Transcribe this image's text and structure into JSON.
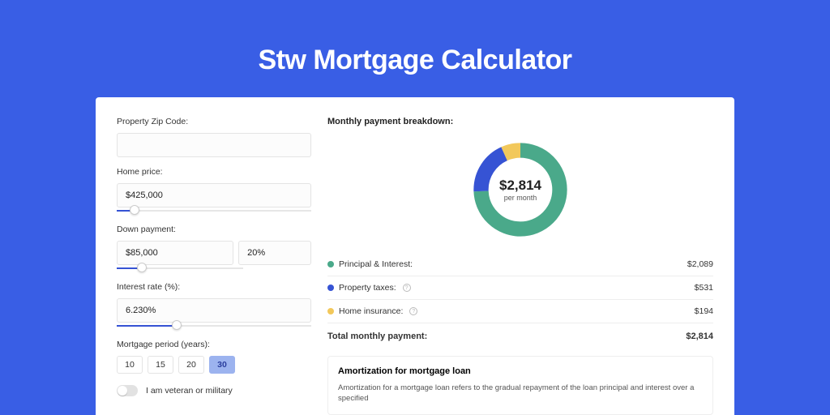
{
  "page": {
    "title": "Stw Mortgage Calculator"
  },
  "form": {
    "zip_label": "Property Zip Code:",
    "zip_value": "",
    "home_price_label": "Home price:",
    "home_price_value": "$425,000",
    "home_price_slider_pct": 9,
    "down_payment_label": "Down payment:",
    "down_payment_value": "$85,000",
    "down_payment_pct_value": "20%",
    "down_payment_slider_pct": 20,
    "interest_label": "Interest rate (%):",
    "interest_value": "6.230%",
    "interest_slider_pct": 31,
    "period_label": "Mortgage period (years):",
    "period_options": [
      "10",
      "15",
      "20",
      "30"
    ],
    "period_selected": "30",
    "veteran_label": "I am veteran or military",
    "veteran_on": false
  },
  "breakdown": {
    "title": "Monthly payment breakdown:",
    "center_amount": "$2,814",
    "center_sub": "per month",
    "items": [
      {
        "label": "Principal & Interest:",
        "value": "$2,089",
        "color": "#4aa98a",
        "info": false
      },
      {
        "label": "Property taxes:",
        "value": "$531",
        "color": "#3653d4",
        "info": true
      },
      {
        "label": "Home insurance:",
        "value": "$194",
        "color": "#f2c85b",
        "info": true
      }
    ],
    "total_label": "Total monthly payment:",
    "total_value": "$2,814"
  },
  "amortization": {
    "title": "Amortization for mortgage loan",
    "text": "Amortization for a mortgage loan refers to the gradual repayment of the loan principal and interest over a specified"
  },
  "chart_data": {
    "type": "pie",
    "title": "Monthly payment breakdown",
    "series": [
      {
        "name": "Principal & Interest",
        "value": 2089,
        "color": "#4aa98a"
      },
      {
        "name": "Property taxes",
        "value": 531,
        "color": "#3653d4"
      },
      {
        "name": "Home insurance",
        "value": 194,
        "color": "#f2c85b"
      }
    ],
    "total": 2814,
    "center_label": "$2,814 per month"
  }
}
